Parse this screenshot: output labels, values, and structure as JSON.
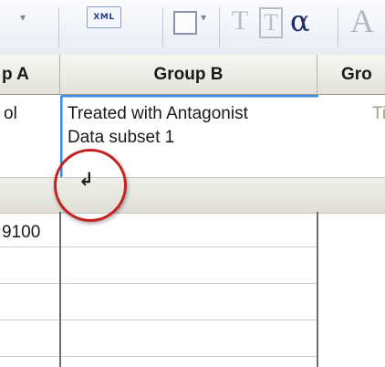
{
  "toolbar": {
    "dropdown_arrow": "▾",
    "xml_label": "XML",
    "text_style_1": "T",
    "text_style_2": "T",
    "greek_label": "α",
    "font_letter": "A"
  },
  "headers": {
    "group_a": "p A",
    "group_b": "Group B",
    "group_c": "Gro"
  },
  "cells": {
    "a_title": "ol",
    "b_title_line1": "Treated with Antagonist",
    "b_title_line2": "Data subset 1",
    "c_title": "Ti",
    "a_value": "9100",
    "return_symbol": "↲"
  },
  "colors": {
    "active_border": "#3a8ee6",
    "highlight_circle": "#c42121",
    "faded_text": "#9aa58a"
  }
}
